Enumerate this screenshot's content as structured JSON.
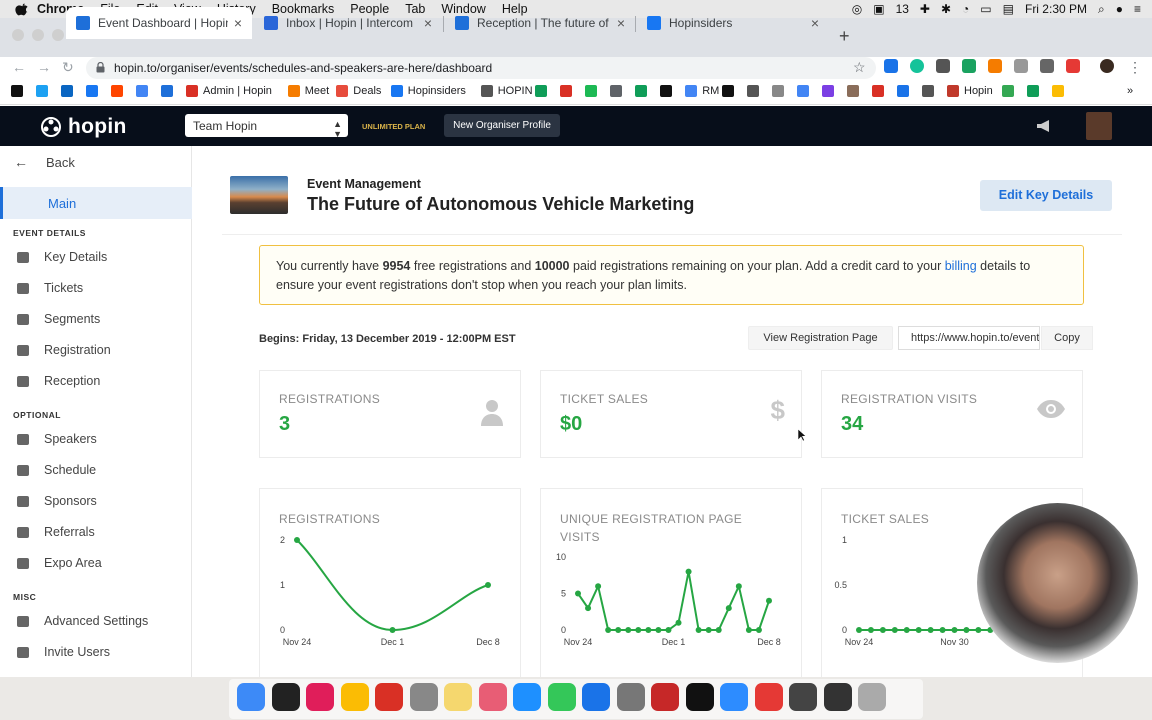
{
  "menubar": {
    "items": [
      "Chrome",
      "File",
      "Edit",
      "View",
      "History",
      "Bookmarks",
      "People",
      "Tab",
      "Window",
      "Help"
    ],
    "badge": "13",
    "clock": "Fri 2:30 PM"
  },
  "tabs": [
    {
      "title": "Event Dashboard | Hopin",
      "active": true,
      "color": "#1e6fd9"
    },
    {
      "title": "Inbox | Hopin | Intercom",
      "active": false,
      "color": "#2a66d8"
    },
    {
      "title": "Reception | The future of autonom",
      "active": false,
      "color": "#1e6fd9"
    },
    {
      "title": "Hopinsiders",
      "active": false,
      "color": "#1877f2"
    }
  ],
  "url": "hopin.to/organiser/events/schedules-and-speakers-are-here/dashboard",
  "bookmarks": [
    {
      "label": "",
      "color": "#111"
    },
    {
      "label": "",
      "color": "#1da1f2"
    },
    {
      "label": "",
      "color": "#0a66c2"
    },
    {
      "label": "",
      "color": "#1877f2"
    },
    {
      "label": "",
      "color": "#ff4500"
    },
    {
      "label": "",
      "color": "#4285f4"
    },
    {
      "label": "",
      "color": "#1e6fd9"
    },
    {
      "label": "Admin | Hopin",
      "color": "#d93025"
    },
    {
      "label": "Meet",
      "color": "#f57c00"
    },
    {
      "label": "Deals",
      "color": "#e74c3c"
    },
    {
      "label": "Hopinsiders",
      "color": "#1877f2"
    },
    {
      "label": "HOPIN",
      "color": "#555"
    },
    {
      "label": "",
      "color": "#0f9d58"
    },
    {
      "label": "",
      "color": "#d93025"
    },
    {
      "label": "",
      "color": "#1db954"
    },
    {
      "label": "",
      "color": "#5f6368"
    },
    {
      "label": "",
      "color": "#0f9d58"
    },
    {
      "label": "",
      "color": "#111"
    },
    {
      "label": "RM",
      "color": "#4285f4"
    },
    {
      "label": "",
      "color": "#111"
    },
    {
      "label": "",
      "color": "#555"
    },
    {
      "label": "",
      "color": "#888"
    },
    {
      "label": "",
      "color": "#4285f4"
    },
    {
      "label": "",
      "color": "#7b3fe4"
    },
    {
      "label": "",
      "color": "#8a6d5a"
    },
    {
      "label": "",
      "color": "#d93025"
    },
    {
      "label": "",
      "color": "#1a73e8"
    },
    {
      "label": "",
      "color": "#555"
    },
    {
      "label": "Hopin",
      "color": "#c0392b"
    },
    {
      "label": "",
      "color": "#34a853"
    },
    {
      "label": "",
      "color": "#0f9d58"
    },
    {
      "label": "",
      "color": "#fbbc04"
    }
  ],
  "header": {
    "logo": "hopin",
    "team": "Team Hopin",
    "plan": "UNLIMITED PLAN",
    "new_profile": "New Organiser Profile"
  },
  "sidebar": {
    "back": "Back",
    "main": "Main",
    "sections": [
      {
        "heading": "EVENT DETAILS",
        "items": [
          "Key Details",
          "Tickets",
          "Segments",
          "Registration",
          "Reception"
        ]
      },
      {
        "heading": "OPTIONAL",
        "items": [
          "Speakers",
          "Schedule",
          "Sponsors",
          "Referrals",
          "Expo Area"
        ]
      },
      {
        "heading": "MISC",
        "items": [
          "Advanced Settings",
          "Invite Users"
        ]
      }
    ]
  },
  "event": {
    "label": "Event Management",
    "title": "The Future of Autonomous Vehicle Marketing",
    "edit_button": "Edit Key Details"
  },
  "notice": {
    "pre": "You currently have ",
    "free": "9954",
    "mid": " free registrations and ",
    "paid": "10000",
    "post": " paid registrations remaining on your plan. Add a credit card to your ",
    "link": "billing",
    "end": " details to ensure your event registrations don't stop when you reach your plan limits."
  },
  "begins": "Begins: Friday, 13 December 2019 - 12:00PM EST",
  "registration_page": {
    "view": "View Registration Page",
    "url": "https://www.hopin.to/events/schedules-and-speakers-are-here",
    "copy": "Copy"
  },
  "stats": [
    {
      "label": "REGISTRATIONS",
      "value": "3",
      "icon": "user-icon"
    },
    {
      "label": "TICKET SALES",
      "value": "$0",
      "icon": "dollar-icon"
    },
    {
      "label": "REGISTRATION VISITS",
      "value": "34",
      "icon": "eye-icon"
    }
  ],
  "chart_data": [
    {
      "type": "line",
      "title": "REGISTRATIONS",
      "x": [
        "Nov 24",
        "Dec 1",
        "Dec 8"
      ],
      "y": [
        2,
        0,
        1
      ],
      "ylim": [
        0,
        2
      ],
      "yticks": [
        "2",
        "1",
        "0"
      ],
      "xticks": [
        "Nov 24",
        "Dec 1",
        "Dec 8"
      ]
    },
    {
      "type": "line",
      "title": "UNIQUE REGISTRATION PAGE VISITS",
      "y": [
        5,
        3,
        6,
        0,
        0,
        0,
        0,
        0,
        0,
        0,
        1,
        8,
        0,
        0,
        0,
        3,
        6,
        0,
        0,
        4
      ],
      "ylim": [
        0,
        10
      ],
      "yticks": [
        "10",
        "5",
        "0"
      ],
      "xticks": [
        "Nov 24",
        "Dec 1",
        "Dec 8"
      ]
    },
    {
      "type": "line",
      "title": "TICKET SALES",
      "y": [
        0,
        0,
        0,
        0,
        0,
        0,
        0,
        0,
        0,
        0,
        0,
        0,
        0,
        0,
        0,
        0,
        0
      ],
      "ylim": [
        0,
        1
      ],
      "yticks": [
        "1",
        "0.5",
        "0"
      ],
      "xticks": [
        "Nov 24",
        "Nov 30",
        "De"
      ]
    }
  ],
  "dock_colors": [
    "#3d8af7",
    "#222",
    "#e01e5a",
    "#fbbc04",
    "#d93025",
    "#888",
    "#f5d76e",
    "#e85d75",
    "#1e90ff",
    "#34c759",
    "#1a73e8",
    "#777",
    "#c62828",
    "#111",
    "#2d8cff",
    "#e53935",
    "#444",
    "#333",
    "#aaa"
  ]
}
